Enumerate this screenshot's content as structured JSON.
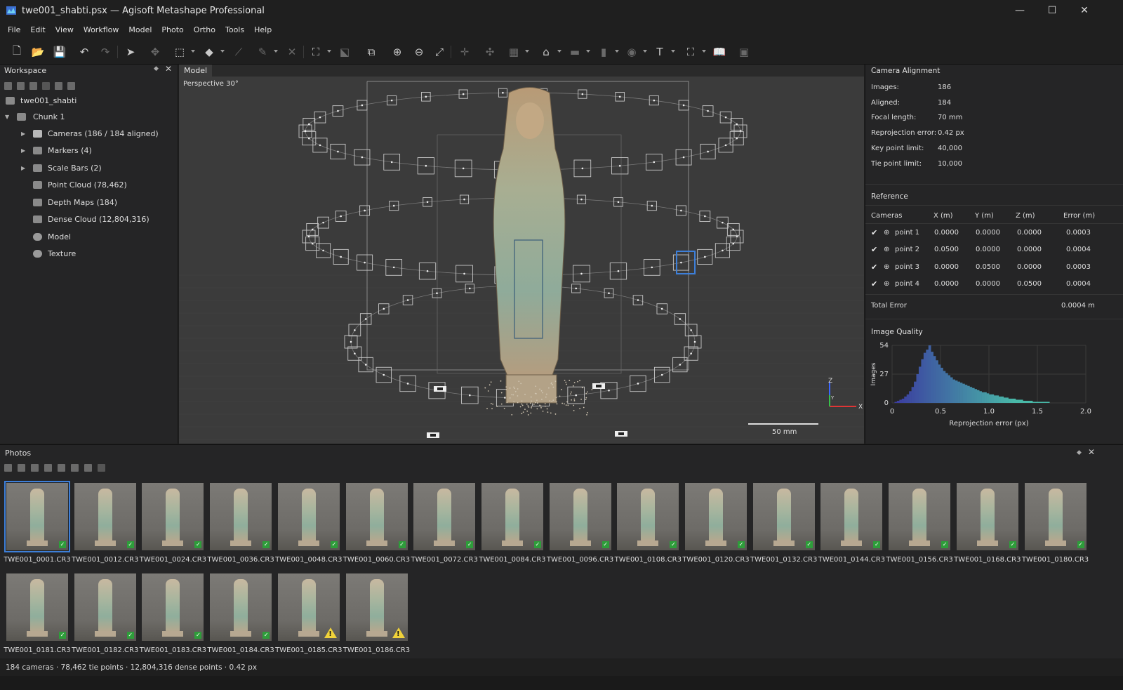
{
  "window": {
    "title": "twe001_shabti.psx — Agisoft Metashape Professional",
    "minimize": "—",
    "maximize": "☐",
    "close": "✕"
  },
  "menu": [
    "File",
    "Edit",
    "View",
    "Workflow",
    "Model",
    "Photo",
    "Ortho",
    "Tools",
    "Help"
  ],
  "workspace": {
    "title": "Workspace",
    "tree": [
      {
        "label": "twe001_shabti",
        "icon": "project-icon"
      },
      {
        "label": "Chunk 1",
        "icon": "chunk-icon"
      },
      {
        "label": "Cameras (186 / 184 aligned)",
        "icon": "folder-icon"
      },
      {
        "label": "Markers (4)",
        "icon": "markers-icon"
      },
      {
        "label": "Scale Bars (2)",
        "icon": "scalebar-icon"
      },
      {
        "label": "Point Cloud (78,462)",
        "icon": "point-cloud-icon"
      },
      {
        "label": "Depth Maps (184)",
        "icon": "depth-maps-icon"
      },
      {
        "label": "Dense Cloud (12,804,316)",
        "icon": "dense-cloud-icon"
      },
      {
        "label": "Model",
        "icon": "model-icon"
      },
      {
        "label": "Texture",
        "icon": "texture-icon"
      }
    ]
  },
  "viewport": {
    "tab": "Model",
    "projection": "Perspective 30°",
    "scale_label": "50 mm",
    "axis_z": "Z",
    "axis_y": "Y",
    "axis_x": "X"
  },
  "camera_alignment": {
    "title": "Camera Alignment",
    "rows": [
      {
        "k": "Images:",
        "v": "186"
      },
      {
        "k": "Aligned:",
        "v": "184"
      },
      {
        "k": "Focal length:",
        "v": "70 mm"
      },
      {
        "k": "Reprojection error:",
        "v": "0.42 px"
      },
      {
        "k": "Key point limit:",
        "v": "40,000"
      },
      {
        "k": "Tie point limit:",
        "v": "10,000"
      }
    ]
  },
  "reference": {
    "title": "Reference",
    "headers": [
      "Cameras",
      "X (m)",
      "Y (m)",
      "Z (m)",
      "Error (m)"
    ],
    "rows": [
      {
        "name": "point 1",
        "x": "0.0000",
        "y": "0.0000",
        "z": "0.0000",
        "err": "0.0003"
      },
      {
        "name": "point 2",
        "x": "0.0500",
        "y": "0.0000",
        "z": "0.0000",
        "err": "0.0004"
      },
      {
        "name": "point 3",
        "x": "0.0000",
        "y": "0.0500",
        "z": "0.0000",
        "err": "0.0003"
      },
      {
        "name": "point 4",
        "x": "0.0000",
        "y": "0.0000",
        "z": "0.0500",
        "err": "0.0004"
      }
    ],
    "total_label": "Total Error",
    "total_value": "0.0004 m"
  },
  "image_quality": {
    "title": "Image Quality",
    "ylabel": "Images",
    "xlabel": "Reprojection error (px)",
    "yticks": [
      "54",
      "27",
      "0"
    ],
    "xticks": [
      "0",
      "0.5",
      "1.0",
      "1.5",
      "2.0"
    ]
  },
  "chart_data": {
    "type": "bar",
    "xlabel": "Reprojection error (px)",
    "ylabel": "Images",
    "xlim": [
      0,
      2.0
    ],
    "ylim": [
      0,
      54
    ],
    "bin_width": 0.025,
    "values": [
      0,
      1,
      2,
      3,
      4,
      6,
      8,
      11,
      15,
      20,
      27,
      34,
      41,
      47,
      50,
      54,
      48,
      44,
      40,
      36,
      33,
      30,
      28,
      26,
      24,
      22,
      21,
      20,
      19,
      18,
      17,
      16,
      15,
      14,
      13,
      12,
      11,
      10,
      10,
      9,
      8,
      8,
      7,
      7,
      6,
      6,
      5,
      5,
      4,
      4,
      4,
      3,
      3,
      3,
      2,
      2,
      2,
      2,
      1,
      1,
      1,
      1,
      1,
      1,
      1,
      0,
      0,
      0,
      0,
      0,
      0,
      0,
      0,
      0,
      0,
      0,
      0,
      0,
      0,
      0
    ],
    "color_start": "#3b3aa0",
    "color_end": "#49b9a8"
  },
  "photos": {
    "title": "Photos",
    "items": [
      {
        "name": "TWE001_0001.CR3",
        "status": "ok",
        "selected": true
      },
      {
        "name": "TWE001_0012.CR3",
        "status": "ok"
      },
      {
        "name": "TWE001_0024.CR3",
        "status": "ok"
      },
      {
        "name": "TWE001_0036.CR3",
        "status": "ok"
      },
      {
        "name": "TWE001_0048.CR3",
        "status": "ok"
      },
      {
        "name": "TWE001_0060.CR3",
        "status": "ok"
      },
      {
        "name": "TWE001_0072.CR3",
        "status": "ok"
      },
      {
        "name": "TWE001_0084.CR3",
        "status": "ok"
      },
      {
        "name": "TWE001_0096.CR3",
        "status": "ok"
      },
      {
        "name": "TWE001_0108.CR3",
        "status": "ok"
      },
      {
        "name": "TWE001_0120.CR3",
        "status": "ok"
      },
      {
        "name": "TWE001_0132.CR3",
        "status": "ok"
      },
      {
        "name": "TWE001_0144.CR3",
        "status": "ok"
      },
      {
        "name": "TWE001_0156.CR3",
        "status": "ok"
      },
      {
        "name": "TWE001_0168.CR3",
        "status": "ok"
      },
      {
        "name": "TWE001_0180.CR3",
        "status": "ok"
      },
      {
        "name": "TWE001_0181.CR3",
        "status": "ok"
      },
      {
        "name": "TWE001_0182.CR3",
        "status": "ok"
      },
      {
        "name": "TWE001_0183.CR3",
        "status": "ok"
      },
      {
        "name": "TWE001_0184.CR3",
        "status": "ok"
      },
      {
        "name": "TWE001_0185.CR3",
        "status": "warning"
      },
      {
        "name": "TWE001_0186.CR3",
        "status": "warning"
      }
    ]
  },
  "status": "184 cameras  ·  78,462 tie points  ·  12,804,316 dense points  ·  0.42 px",
  "colors": {
    "accent": "#3d7fd9",
    "ok": "#2e9d3a",
    "warning": "#f0d23a"
  }
}
